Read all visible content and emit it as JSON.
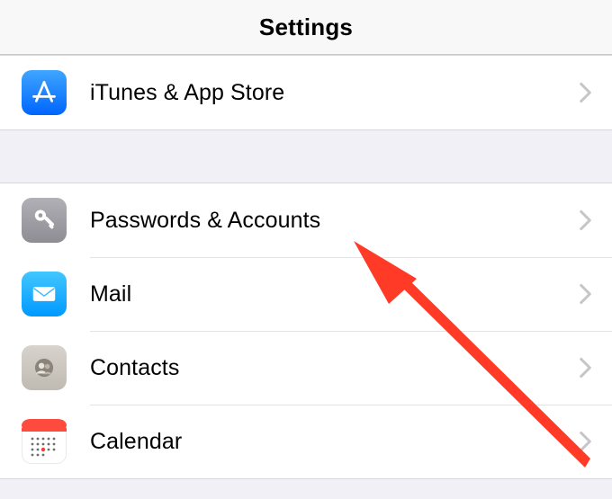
{
  "header": {
    "title": "Settings"
  },
  "group1": {
    "items": [
      {
        "label": "iTunes & App Store",
        "icon": "appstore"
      }
    ]
  },
  "group2": {
    "items": [
      {
        "label": "Passwords & Accounts",
        "icon": "key"
      },
      {
        "label": "Mail",
        "icon": "mail"
      },
      {
        "label": "Contacts",
        "icon": "contacts"
      },
      {
        "label": "Calendar",
        "icon": "calendar"
      }
    ]
  },
  "colors": {
    "annotation_arrow": "#ff3a26"
  }
}
